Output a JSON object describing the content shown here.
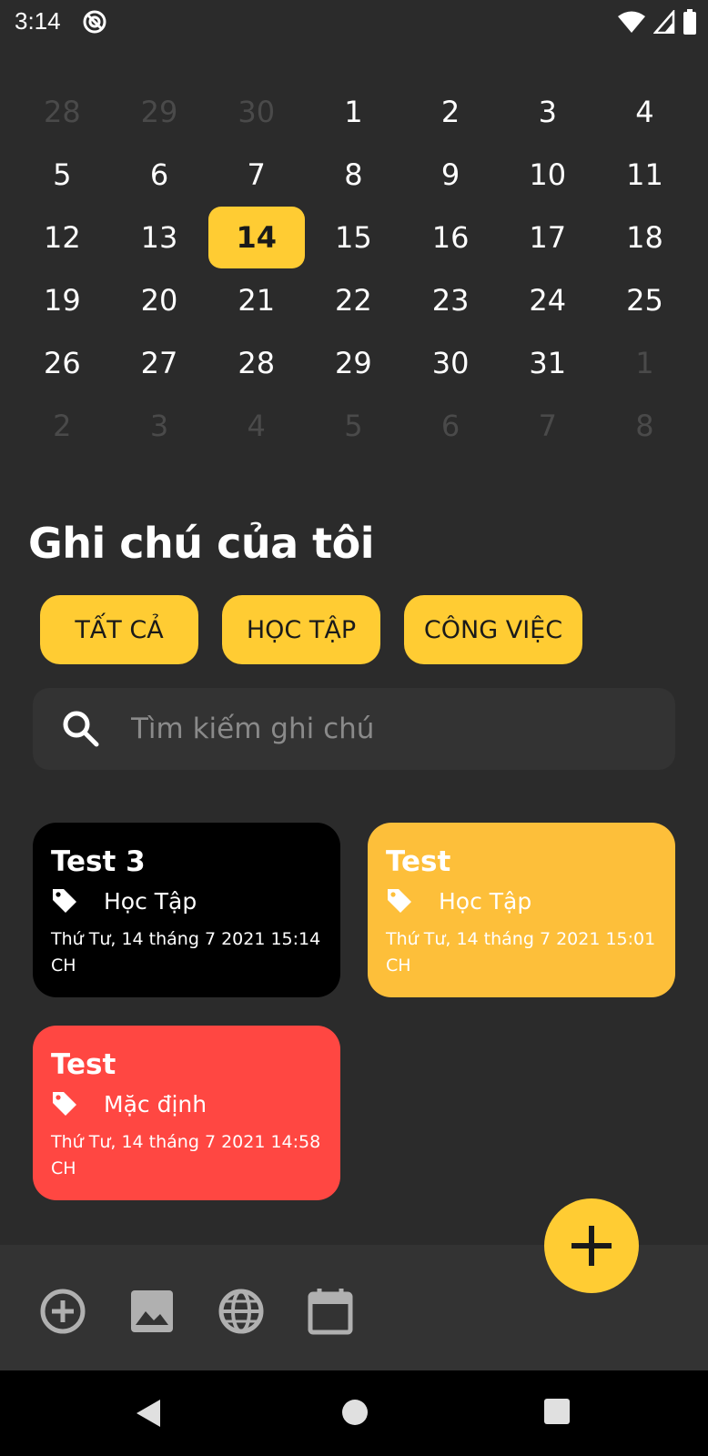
{
  "status_bar": {
    "time": "3:14"
  },
  "calendar": {
    "rows": [
      [
        {
          "d": "28",
          "dim": true
        },
        {
          "d": "29",
          "dim": true
        },
        {
          "d": "30",
          "dim": true
        },
        {
          "d": "1"
        },
        {
          "d": "2"
        },
        {
          "d": "3"
        },
        {
          "d": "4"
        }
      ],
      [
        {
          "d": "5"
        },
        {
          "d": "6"
        },
        {
          "d": "7"
        },
        {
          "d": "8"
        },
        {
          "d": "9"
        },
        {
          "d": "10"
        },
        {
          "d": "11"
        }
      ],
      [
        {
          "d": "12"
        },
        {
          "d": "13"
        },
        {
          "d": "14",
          "selected": true
        },
        {
          "d": "15"
        },
        {
          "d": "16"
        },
        {
          "d": "17"
        },
        {
          "d": "18"
        }
      ],
      [
        {
          "d": "19"
        },
        {
          "d": "20"
        },
        {
          "d": "21"
        },
        {
          "d": "22"
        },
        {
          "d": "23"
        },
        {
          "d": "24"
        },
        {
          "d": "25"
        }
      ],
      [
        {
          "d": "26"
        },
        {
          "d": "27"
        },
        {
          "d": "28"
        },
        {
          "d": "29"
        },
        {
          "d": "30"
        },
        {
          "d": "31"
        },
        {
          "d": "1",
          "dim": true
        }
      ],
      [
        {
          "d": "2",
          "dim": true
        },
        {
          "d": "3",
          "dim": true
        },
        {
          "d": "4",
          "dim": true
        },
        {
          "d": "5",
          "dim": true
        },
        {
          "d": "6",
          "dim": true
        },
        {
          "d": "7",
          "dim": true
        },
        {
          "d": "8",
          "dim": true
        }
      ]
    ]
  },
  "page_title": "Ghi chú của tôi",
  "filters": [
    "TẤT CẢ",
    "HỌC TẬP",
    "CÔNG VIỆC"
  ],
  "search": {
    "placeholder": "Tìm kiếm ghi chú",
    "value": ""
  },
  "notes": [
    {
      "title": "Test 3",
      "category": "Học Tập",
      "date": "Thứ Tư, 14 tháng 7 2021 15:14 CH",
      "color": "#000000"
    },
    {
      "title": "Test",
      "category": "Học Tập",
      "date": "Thứ Tư, 14 tháng 7 2021 15:01 CH",
      "color": "#fdbf3a"
    },
    {
      "title": "Test",
      "category": "Mặc định",
      "date": "Thứ Tư, 14 tháng 7 2021 14:58 CH",
      "color": "#ff4742"
    }
  ],
  "colors": {
    "accent": "#ffcc33",
    "background": "#2b2b2b",
    "surface": "#333333"
  },
  "bottom_bar_icons": [
    "add-circle-icon",
    "image-icon",
    "globe-icon",
    "calendar-icon"
  ],
  "fab_icon": "plus-icon"
}
